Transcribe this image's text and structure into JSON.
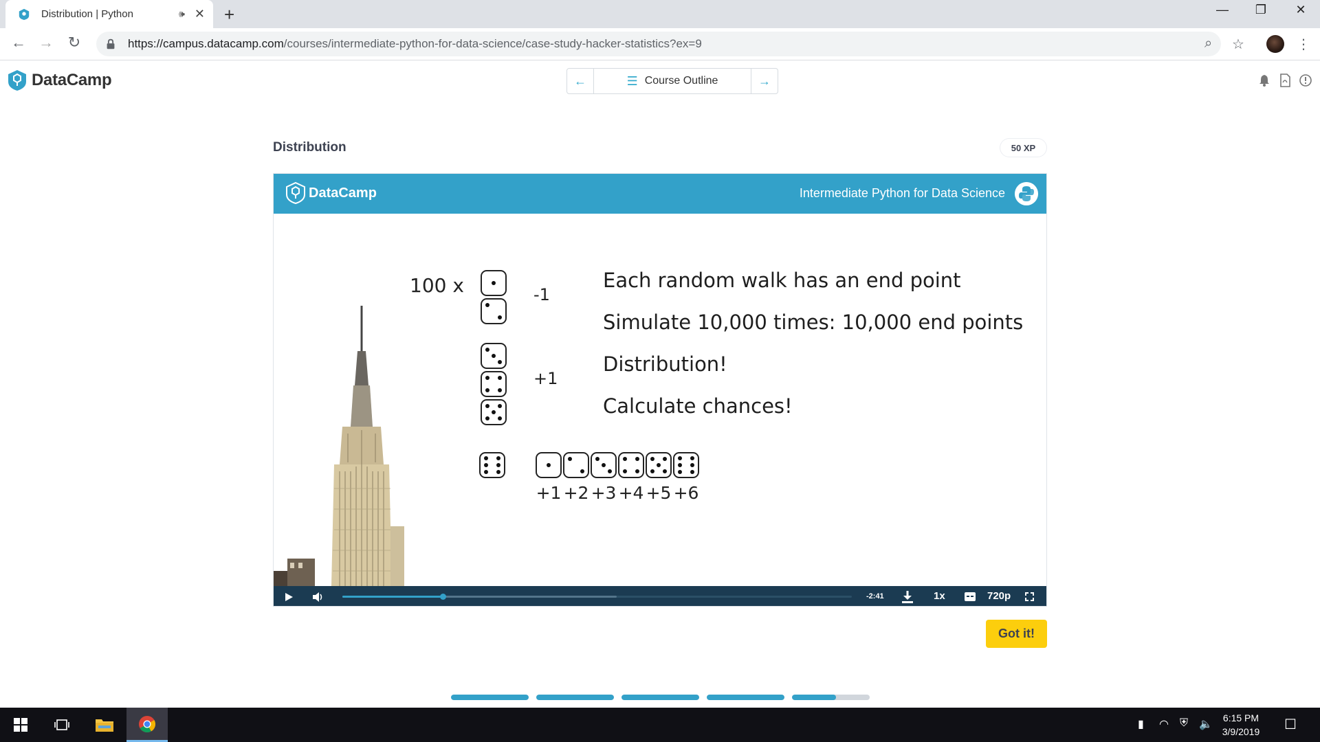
{
  "browser": {
    "tab_title": "Distribution | Python",
    "new_tab": "+",
    "url_host": "https://campus.datacamp.com",
    "url_path": "/courses/intermediate-python-for-data-science/case-study-hacker-statistics?ex=9",
    "icons": [
      "back-icon",
      "forward-icon",
      "reload-icon",
      "lock-icon",
      "zoom-icon",
      "star-icon",
      "menu-icon"
    ]
  },
  "header": {
    "logo_text": "DataCamp",
    "course_outline": "Course Outline"
  },
  "exercise": {
    "title": "Distribution",
    "xp": "50 XP",
    "got_it": "Got it!"
  },
  "slide": {
    "logo_text": "DataCamp",
    "course_name": "Intermediate Python for Data Science",
    "times": "100 x",
    "minus": "-1",
    "plus": "+1",
    "bullets": [
      "Each random walk has an end point",
      "Simulate 10,000 times: 10,000 end points",
      "Distribution!",
      "Calculate chances!"
    ],
    "steps": [
      "+1",
      "+2",
      "+3",
      "+4",
      "+5",
      "+6"
    ]
  },
  "player": {
    "time_remaining": "-2:41",
    "speed": "1x",
    "quality": "720p",
    "played_fraction": 0.197,
    "buffered_fraction": 0.538
  },
  "progress": {
    "segments": [
      1.0,
      1.0,
      1.0,
      1.0,
      0.57
    ]
  },
  "taskbar": {
    "time": "6:15 PM",
    "date": "3/9/2019"
  },
  "colors": {
    "brand_blue": "#33a1c9",
    "got_it_yellow": "#fcce0d",
    "player_bg": "#1b3b52"
  }
}
